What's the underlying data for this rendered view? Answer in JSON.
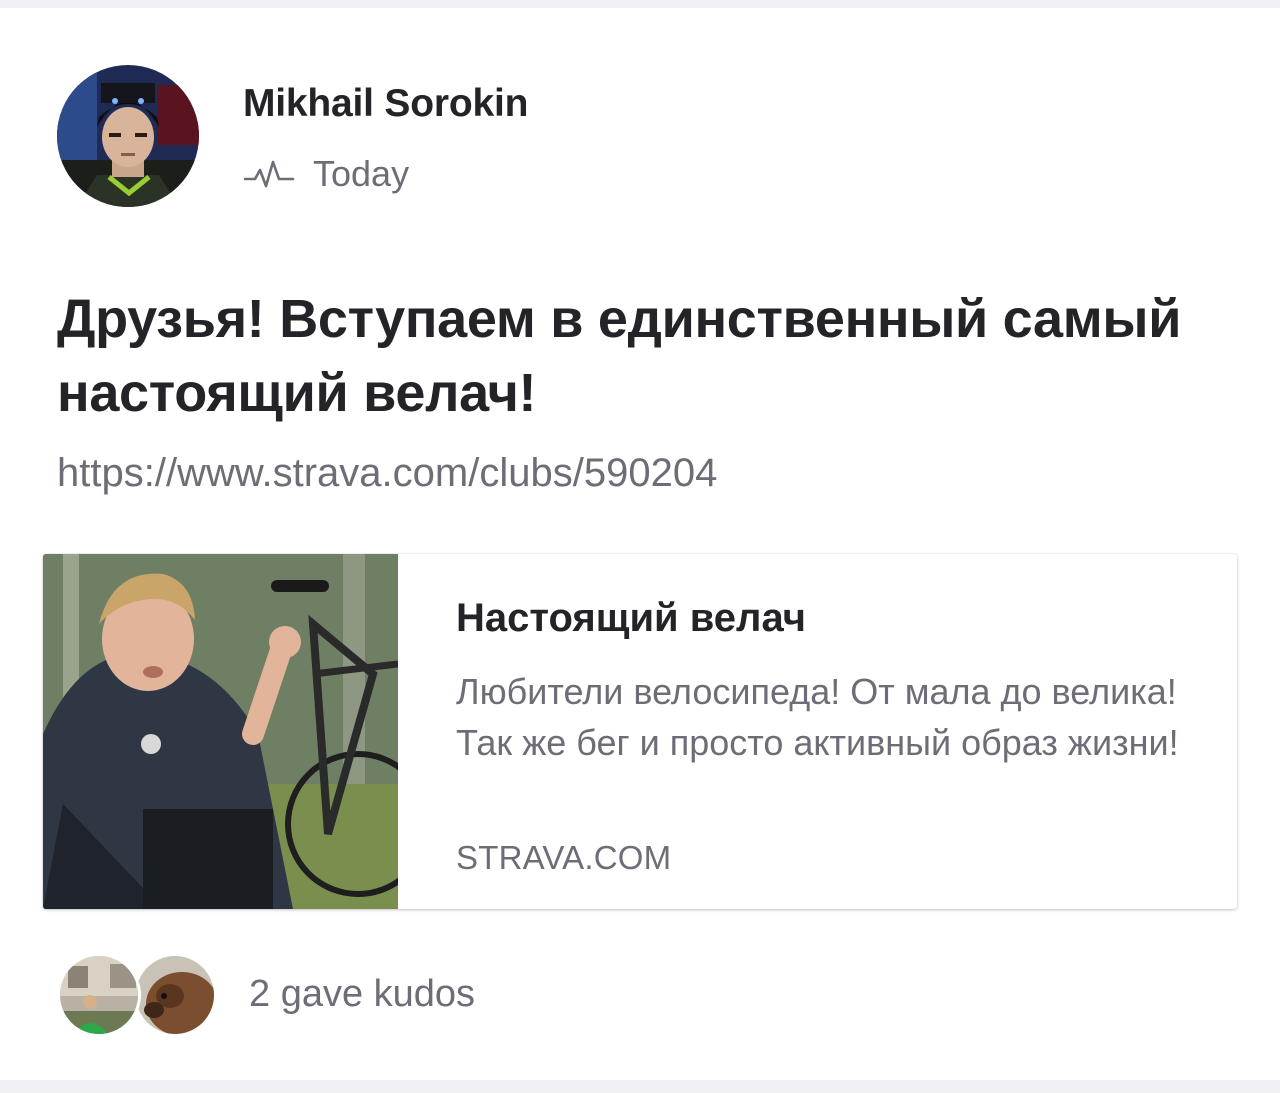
{
  "post": {
    "author": {
      "name": "Mikhail Sorokin",
      "avatar_icon": "user-avatar-cyclist"
    },
    "meta": {
      "activity_icon": "activity-pulse-icon",
      "time": "Today"
    },
    "title": "Друзья! Вступаем в единственный самый настоящий велач!",
    "link": "https://www.strava.com/clubs/590204",
    "link_preview": {
      "image_icon": "club-cover-photo",
      "title": "Настоящий велач",
      "description": "Любители велосипеда! От мала до велика! Так же бег и просто активный образ жизни!",
      "domain": "STRAVA.COM"
    },
    "kudos": {
      "text": "2 gave kudos",
      "avatars": [
        "kudo-avatar-1",
        "kudo-avatar-2"
      ]
    }
  },
  "colors": {
    "page_bg": "#f0f0f4",
    "card_bg": "#ffffff",
    "text_primary": "#242428",
    "text_secondary": "#6d6d78"
  }
}
